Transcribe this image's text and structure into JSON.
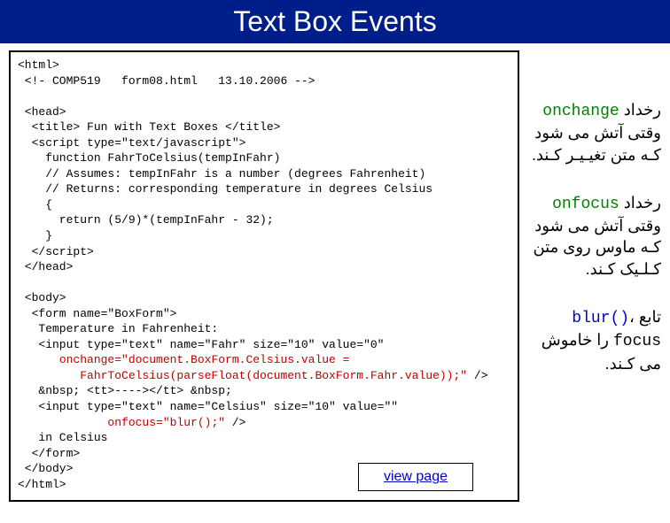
{
  "title": "Text Box Events",
  "code": {
    "l1": "<html>",
    "l2": " <!- COMP519   form08.html   13.10.2006 -->",
    "l3": "",
    "l4": " <head>",
    "l5": "  <title> Fun with Text Boxes </title>",
    "l6": "  <script type=\"text/javascript\">",
    "l7": "    function FahrToCelsius(tempInFahr)",
    "l8": "    // Assumes: tempInFahr is a number (degrees Fahrenheit)",
    "l9": "    // Returns: corresponding temperature in degrees Celsius",
    "l10": "    {",
    "l11": "      return (5/9)*(tempInFahr - 32);",
    "l12": "    }",
    "l13": "  </script>",
    "l14": " </head>",
    "l15": "",
    "l16": " <body>",
    "l17": "  <form name=\"BoxForm\">",
    "l18": "   Temperature in Fahrenheit:",
    "l19": "   <input type=\"text\" name=\"Fahr\" size=\"10\" value=\"0\"",
    "l20a": "      ",
    "l20b": "onchange=\"document.BoxForm.Celsius.value =",
    "l21": "         FahrToCelsius(parseFloat(document.BoxForm.Fahr.value));\"",
    "l21b": " />",
    "l22": "   &nbsp; <tt>----></tt> &nbsp;",
    "l23": "   <input type=\"text\" name=\"Celsius\" size=\"10\" value=\"\"",
    "l24a": "             ",
    "l24b": "onfocus=\"blur();\"",
    "l24c": " />",
    "l25": "   in Celsius",
    "l26": "  </form>",
    "l27": " </body>",
    "l28": "</html>"
  },
  "view_page": "view page",
  "notes": {
    "n1_onchange": "onchange",
    "n1_rest": " رخداد وقتی آتش می شود کـه متن تغیـیـر کـند.",
    "n2_onfocus": "onfocus",
    "n2_rest": " رخداد وقتی آتش می شود کـه ماوس روی متن کـلـیک کـند.",
    "n3_pre": "تابع ",
    "n3_blur": "blur()",
    "n3_mid": "، focus",
    "n3_rest": " را خاموش می کـند."
  }
}
